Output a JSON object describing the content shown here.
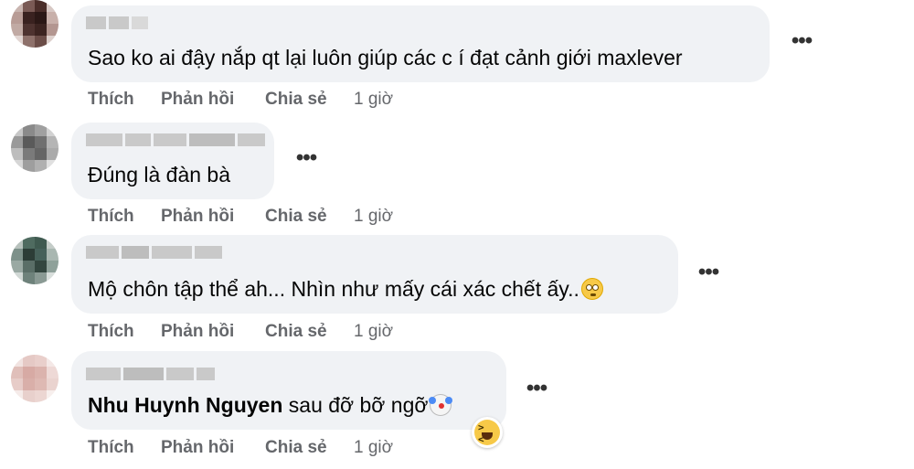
{
  "comments": [
    {
      "text": "Sao ko ai đậy nắp qt lại luôn giúp các c í đạt cảnh giới maxlever",
      "author_name": "",
      "actions": {
        "like": "Thích",
        "reply": "Phản hồi",
        "share": "Chia sẻ",
        "time": "1 giờ"
      }
    },
    {
      "text": "Đúng là đàn bà",
      "author_name": "",
      "actions": {
        "like": "Thích",
        "reply": "Phản hồi",
        "share": "Chia sẻ",
        "time": "1 giờ"
      }
    },
    {
      "text": "Mộ chôn tập thể ah... Nhìn như mấy cái xác chết ấy..",
      "emoji": "flushed-face-icon",
      "author_name": "",
      "actions": {
        "like": "Thích",
        "reply": "Phản hồi",
        "share": "Chia sẻ",
        "time": "1 giờ"
      }
    },
    {
      "mention": "Nhu Huynh Nguyen",
      "text": " sau đỡ bỡ ngỡ",
      "emoji": "clown-face-icon",
      "reaction": "haha-reaction-icon",
      "author_name": "",
      "actions": {
        "like": "Thích",
        "reply": "Phản hồi",
        "share": "Chia sẻ",
        "time": "1 giờ"
      }
    }
  ],
  "more_label": "•••",
  "colors": {
    "bubble": "#f0f2f5",
    "text": "#050505",
    "meta": "#65676b"
  }
}
